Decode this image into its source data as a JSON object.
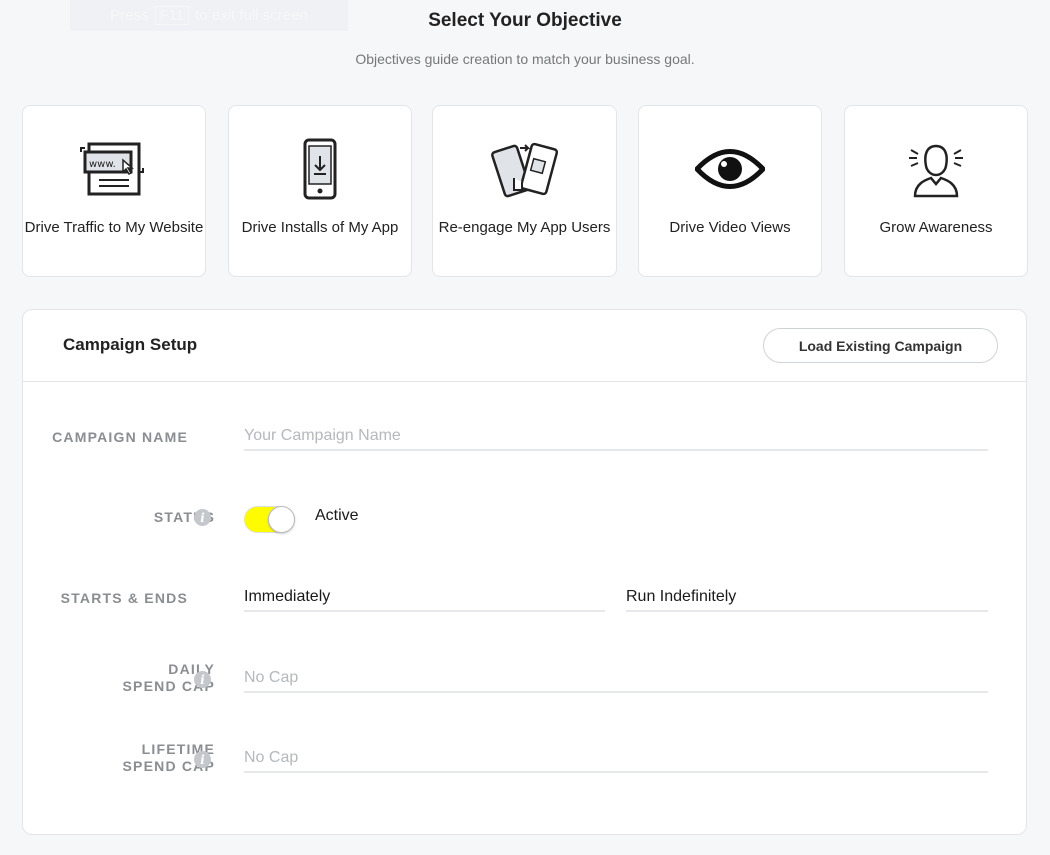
{
  "banner": {
    "pre": "Press",
    "key": "F11",
    "post": "to exit full screen"
  },
  "header": {
    "title": "Select Your Objective",
    "subtitle": "Objectives guide creation to match your business goal."
  },
  "objectives": [
    {
      "label": "Drive Traffic to My Website",
      "icon": "website-icon"
    },
    {
      "label": "Drive Installs of My App",
      "icon": "app-install-icon"
    },
    {
      "label": "Re-engage My App Users",
      "icon": "re-engage-icon"
    },
    {
      "label": "Drive Video Views",
      "icon": "eye-icon"
    },
    {
      "label": "Grow Awareness",
      "icon": "awareness-person-icon"
    }
  ],
  "campaign": {
    "title": "Campaign Setup",
    "load_button": "Load Existing Campaign",
    "name_label": "CAMPAIGN NAME",
    "name_placeholder": "Your Campaign Name",
    "status_label": "STATUS",
    "status_value": "Active",
    "status_on": true,
    "toggle_color": "#fffc00",
    "starts_label": "STARTS & ENDS",
    "starts_value": "Immediately",
    "ends_value": "Run Indefinitely",
    "daily_label_1": "DAILY",
    "daily_label_2": "SPEND CAP",
    "daily_placeholder": "No Cap",
    "lifetime_label_1": "LIFETIME",
    "lifetime_label_2": "SPEND CAP",
    "lifetime_placeholder": "No Cap"
  }
}
